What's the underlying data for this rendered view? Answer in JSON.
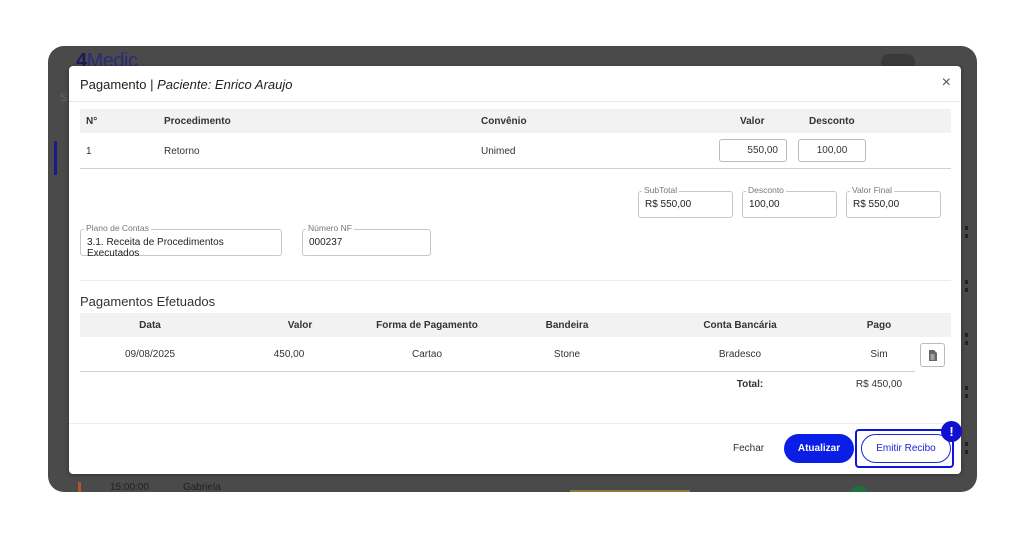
{
  "background": {
    "logo_bold": "4",
    "logo_rest": "Medic",
    "sidebar_letter": "S",
    "row": {
      "time": "15:00:00",
      "name": "Gabriela"
    }
  },
  "modal": {
    "title_prefix": "Pagamento |",
    "title_patient": "Paciente: Enrico Araujo",
    "close_glyph": "×",
    "procedures": {
      "headers": {
        "num": "N°",
        "procedimento": "Procedimento",
        "convenio": "Convênio",
        "valor": "Valor",
        "desconto": "Desconto"
      },
      "rows": [
        {
          "num": "1",
          "procedimento": "Retorno",
          "convenio": "Unimed",
          "valor": "550,00",
          "desconto": "100,00"
        }
      ]
    },
    "summary": {
      "subtotal_label": "SubTotal",
      "subtotal_value": "R$ 550,00",
      "desconto_label": "Desconto",
      "desconto_value": "100,00",
      "valor_final_label": "Valor Final",
      "valor_final_value": "R$ 550,00"
    },
    "fields": {
      "plano_label": "Plano de Contas",
      "plano_value": "3.1. Receita de Procedimentos Executados",
      "nf_label": "Número NF",
      "nf_value": "000237"
    },
    "payments": {
      "section_title": "Pagamentos Efetuados",
      "headers": {
        "data": "Data",
        "valor": "Valor",
        "forma": "Forma de Pagamento",
        "bandeira": "Bandeira",
        "conta": "Conta Bancária",
        "pago": "Pago"
      },
      "rows": [
        {
          "data": "09/08/2025",
          "valor": "450,00",
          "forma": "Cartao",
          "bandeira": "Stone",
          "conta": "Bradesco",
          "pago": "Sim"
        }
      ],
      "total_label": "Total:",
      "total_value": "R$ 450,00"
    },
    "footer": {
      "fechar": "Fechar",
      "atualizar": "Atualizar",
      "emitir_recibo": "Emitir Recibo",
      "alert_glyph": "!"
    }
  },
  "colors": {
    "primary": "#0a1ee6",
    "highlight": "#1014d8",
    "frame": "#4a4a4a"
  },
  "icons": {
    "close": "close-icon",
    "document": "document-icon",
    "alert": "alert-icon"
  }
}
